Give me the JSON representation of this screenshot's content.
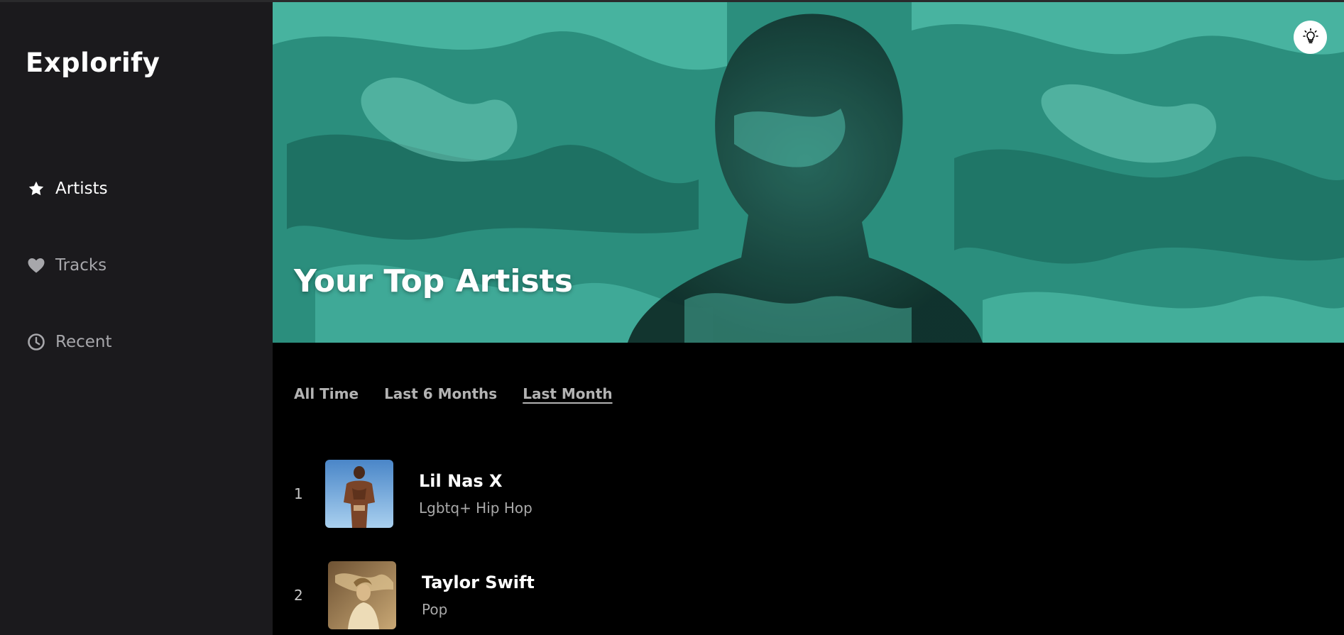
{
  "app": {
    "name": "Explorify"
  },
  "sidebar": {
    "items": [
      {
        "label": "Artists",
        "icon": "star-icon",
        "active": true
      },
      {
        "label": "Tracks",
        "icon": "heart-icon",
        "active": false
      },
      {
        "label": "Recent",
        "icon": "clock-icon",
        "active": false
      }
    ]
  },
  "hero": {
    "title": "Your Top Artists",
    "toggle_icon": "lightbulb-icon",
    "accent": "#4fd1bd"
  },
  "tabs": [
    {
      "label": "All Time",
      "active": false
    },
    {
      "label": "Last 6 Months",
      "active": false
    },
    {
      "label": "Last Month",
      "active": true
    }
  ],
  "artists": [
    {
      "rank": "1",
      "name": "Lil Nas X",
      "genre": "Lgbtq+ Hip Hop"
    },
    {
      "rank": "2",
      "name": "Taylor Swift",
      "genre": "Pop"
    }
  ]
}
